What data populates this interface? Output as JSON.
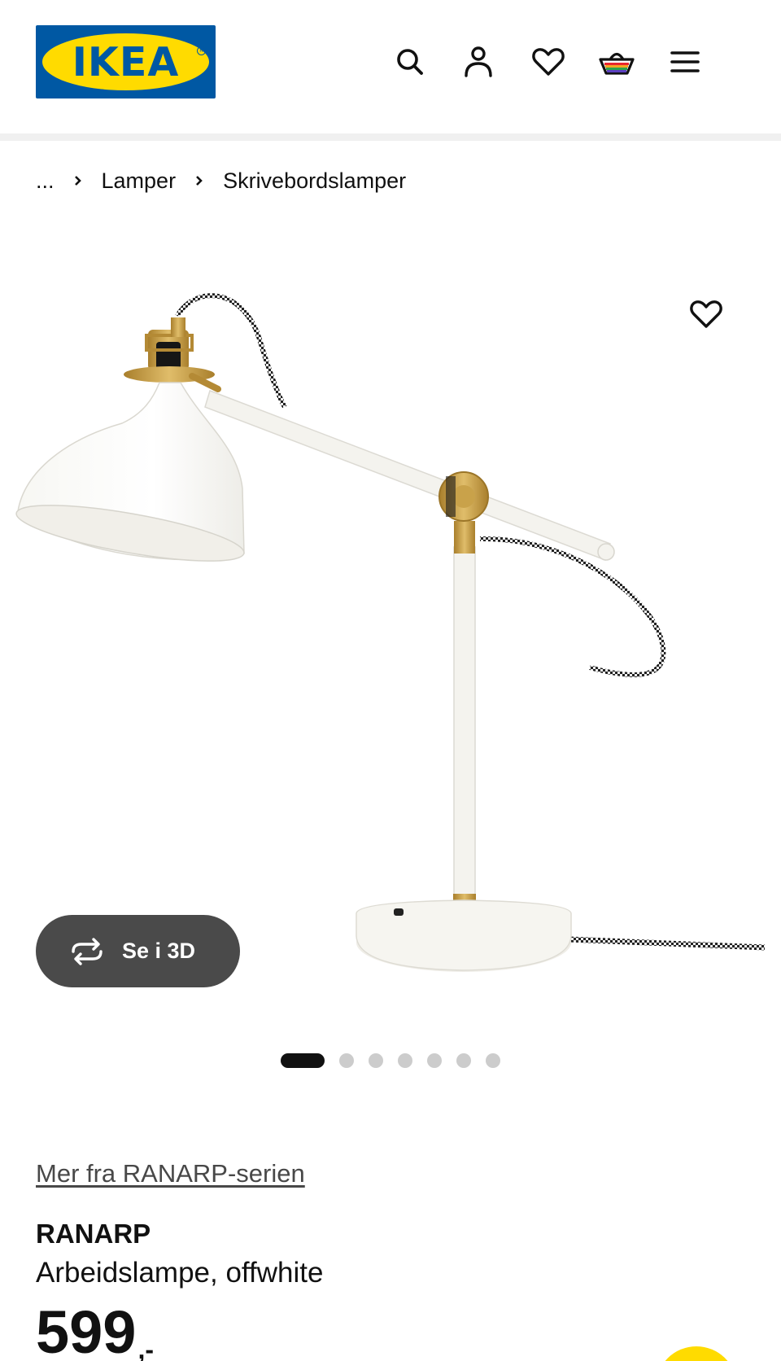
{
  "header": {
    "logo_text": "IKEA",
    "icons": [
      "search-icon",
      "account-icon",
      "heart-icon",
      "basket-icon",
      "menu-icon"
    ]
  },
  "breadcrumb": {
    "items": [
      "...",
      "Lamper",
      "Skrivebordslamper"
    ]
  },
  "gallery": {
    "view_3d_label": "Se i 3D",
    "slide_count": 7,
    "active_slide": 1
  },
  "product": {
    "series_link": "Mer fra RANARP-serien",
    "name": "RANARP",
    "description": "Arbeidslampe, offwhite",
    "price_int": "599",
    "price_dec": ",-"
  },
  "colors": {
    "brand_blue": "#0058a3",
    "brand_yellow": "#ffdb00",
    "lamp_white": "#f6f4ef",
    "brass": "#c9a24a"
  }
}
